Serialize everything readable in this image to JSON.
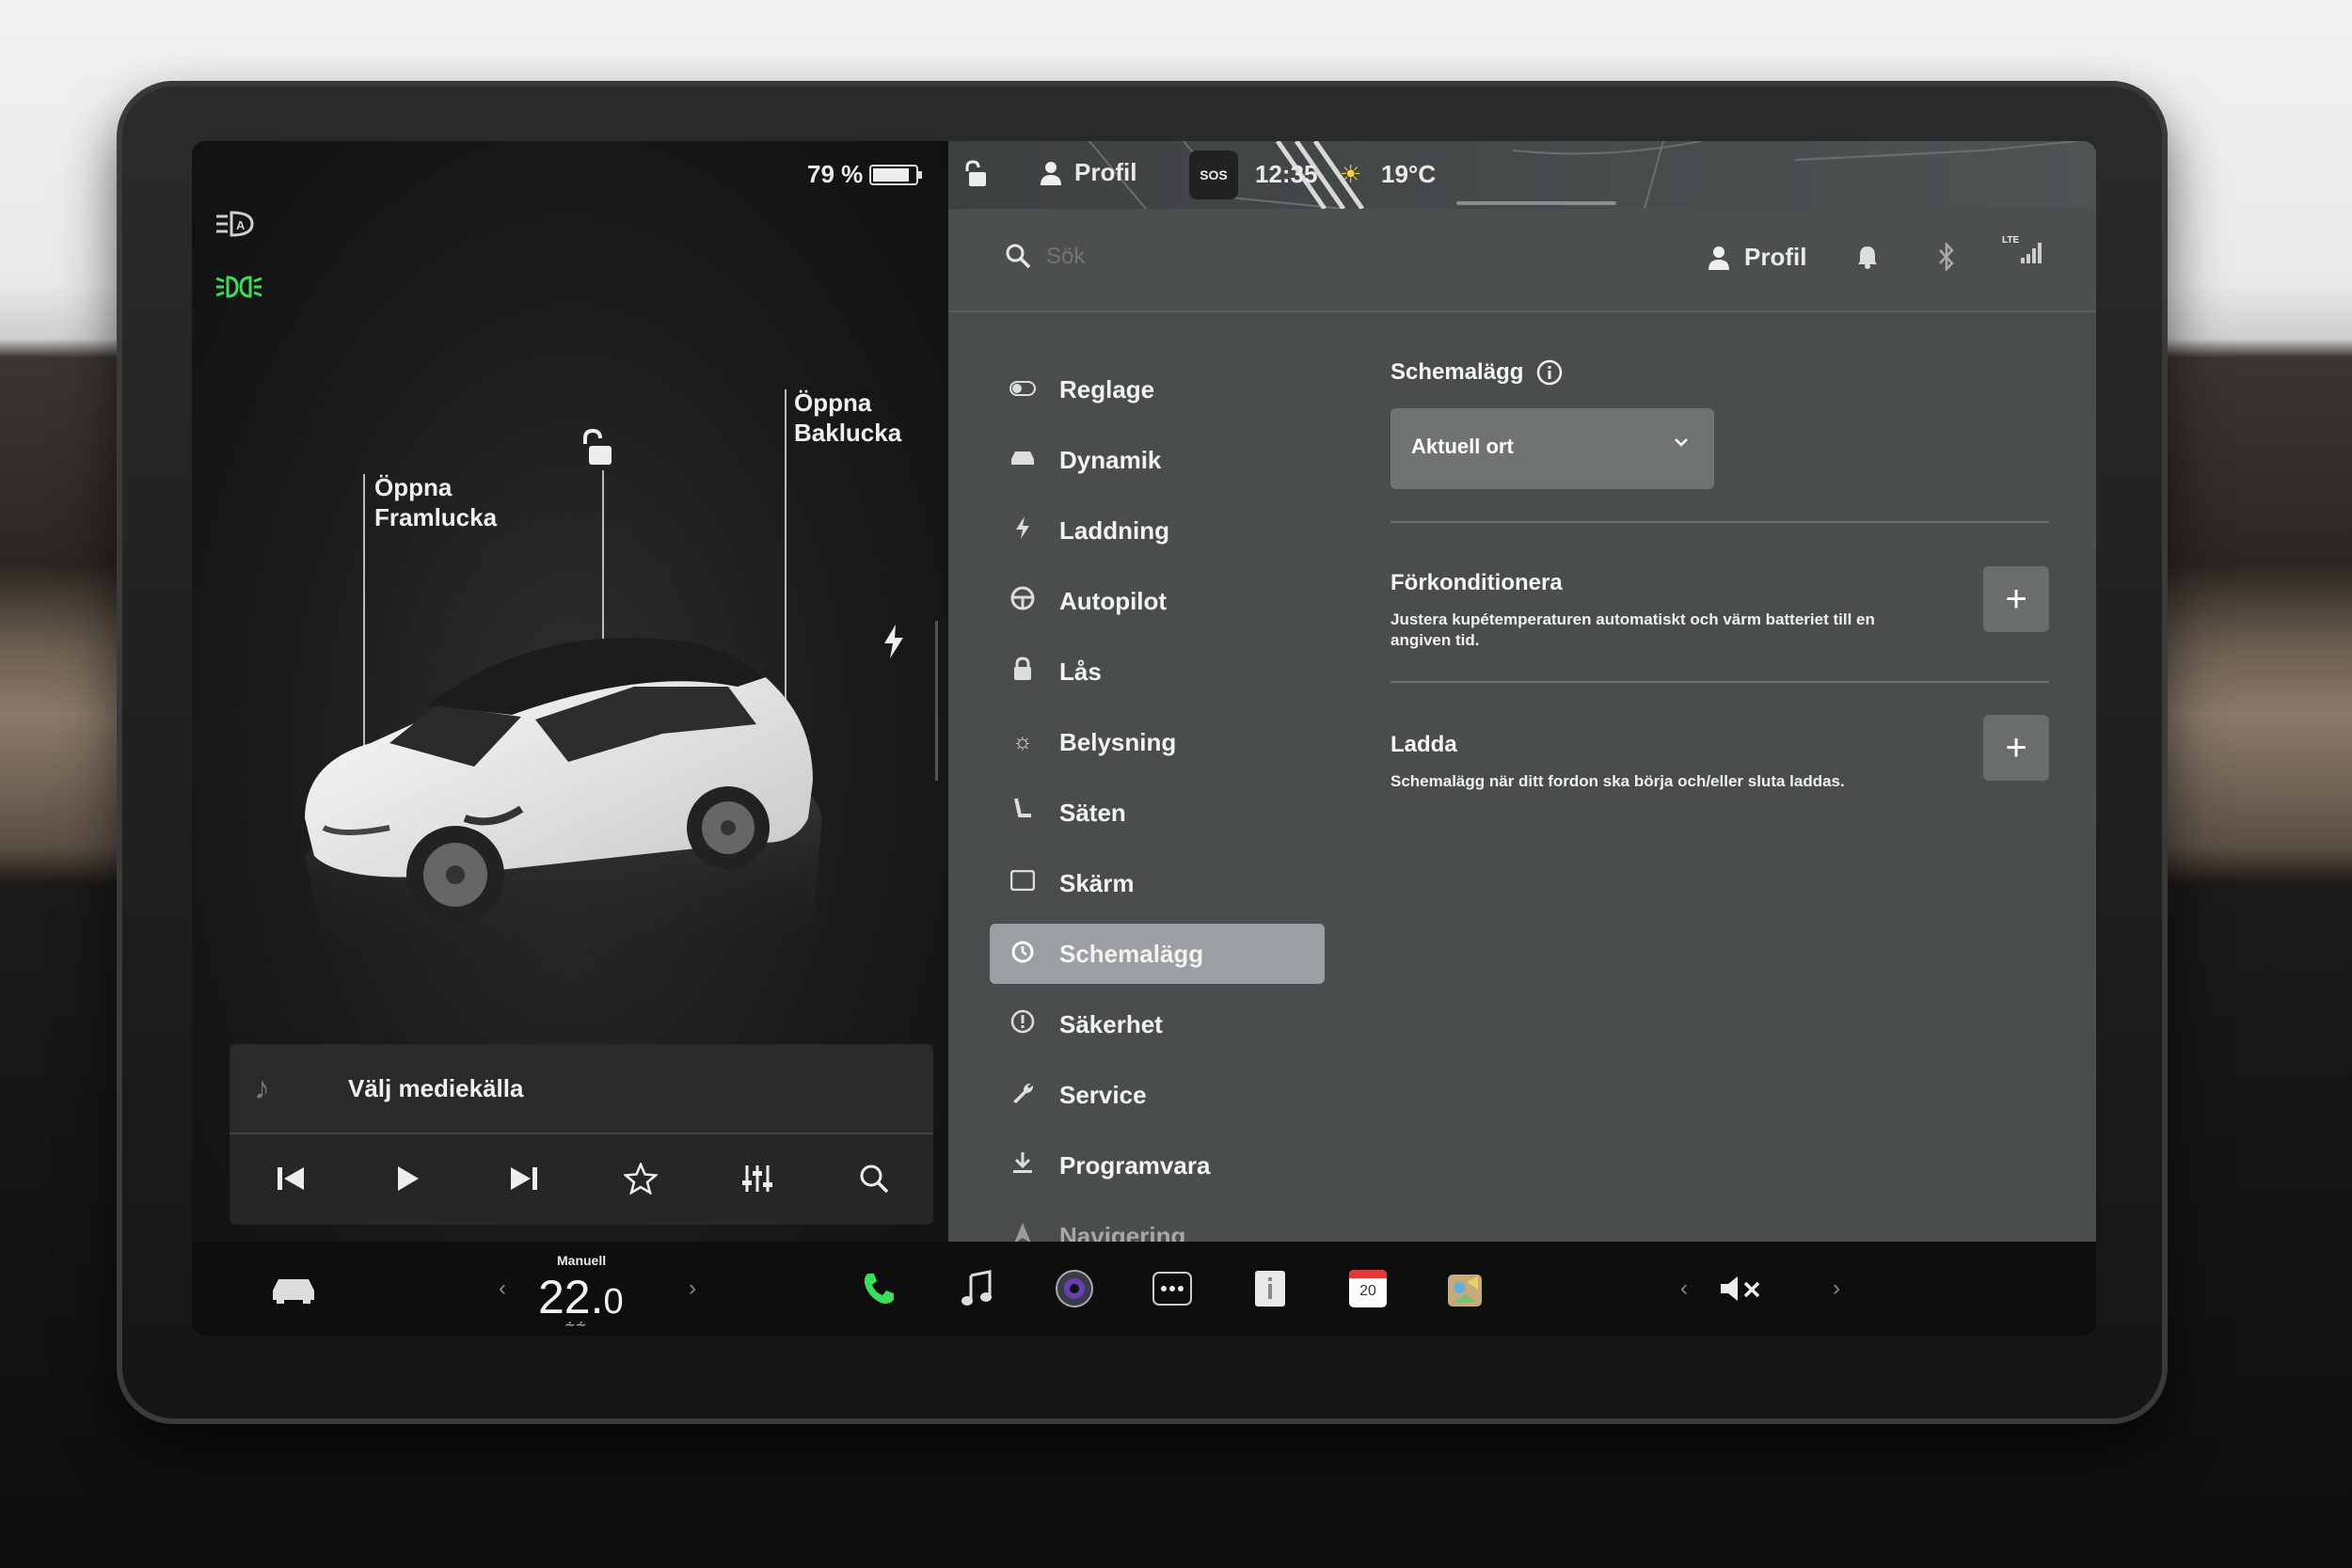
{
  "status": {
    "battery_percent": "79 %",
    "profile_label": "Profil",
    "sos_label": "SOS",
    "time": "12:35",
    "temperature": "19°C"
  },
  "car_panel": {
    "frunk_label_line1": "Öppna",
    "frunk_label_line2": "Framlucka",
    "trunk_label_line1": "Öppna",
    "trunk_label_line2": "Baklucka"
  },
  "media": {
    "source_label": "Välj mediekälla"
  },
  "search": {
    "placeholder": "Sök",
    "profile_label": "Profil",
    "network_label": "LTE"
  },
  "menu": {
    "items": [
      {
        "label": "Reglage",
        "icon": "toggle-icon"
      },
      {
        "label": "Dynamik",
        "icon": "car-icon"
      },
      {
        "label": "Laddning",
        "icon": "bolt-icon"
      },
      {
        "label": "Autopilot",
        "icon": "steering-wheel-icon"
      },
      {
        "label": "Lås",
        "icon": "lock-icon"
      },
      {
        "label": "Belysning",
        "icon": "sun-icon"
      },
      {
        "label": "Säten",
        "icon": "seat-icon"
      },
      {
        "label": "Skärm",
        "icon": "display-icon"
      },
      {
        "label": "Schemalägg",
        "icon": "alarm-clock-icon"
      },
      {
        "label": "Säkerhet",
        "icon": "alert-icon"
      },
      {
        "label": "Service",
        "icon": "wrench-icon"
      },
      {
        "label": "Programvara",
        "icon": "download-icon"
      },
      {
        "label": "Navigering",
        "icon": "navigation-icon"
      }
    ],
    "active_index": 8
  },
  "content": {
    "title": "Schemalägg",
    "location_dropdown_value": "Aktuell ort",
    "precondition": {
      "title": "Förkonditionera",
      "description": "Justera kupétemperaturen automatiskt och värm batteriet till en angiven tid."
    },
    "charge": {
      "title": "Ladda",
      "description": "Schemalägg när ditt fordon ska börja och/eller sluta laddas."
    }
  },
  "taskbar": {
    "climate_mode": "Manuell",
    "temperature_whole": "22.",
    "temperature_decimal": "0",
    "calendar_day": "20"
  },
  "colors": {
    "accent_green": "#3ddc5a",
    "panel_gray": "#4a4d4e",
    "active_item": "#9aa0a2"
  }
}
